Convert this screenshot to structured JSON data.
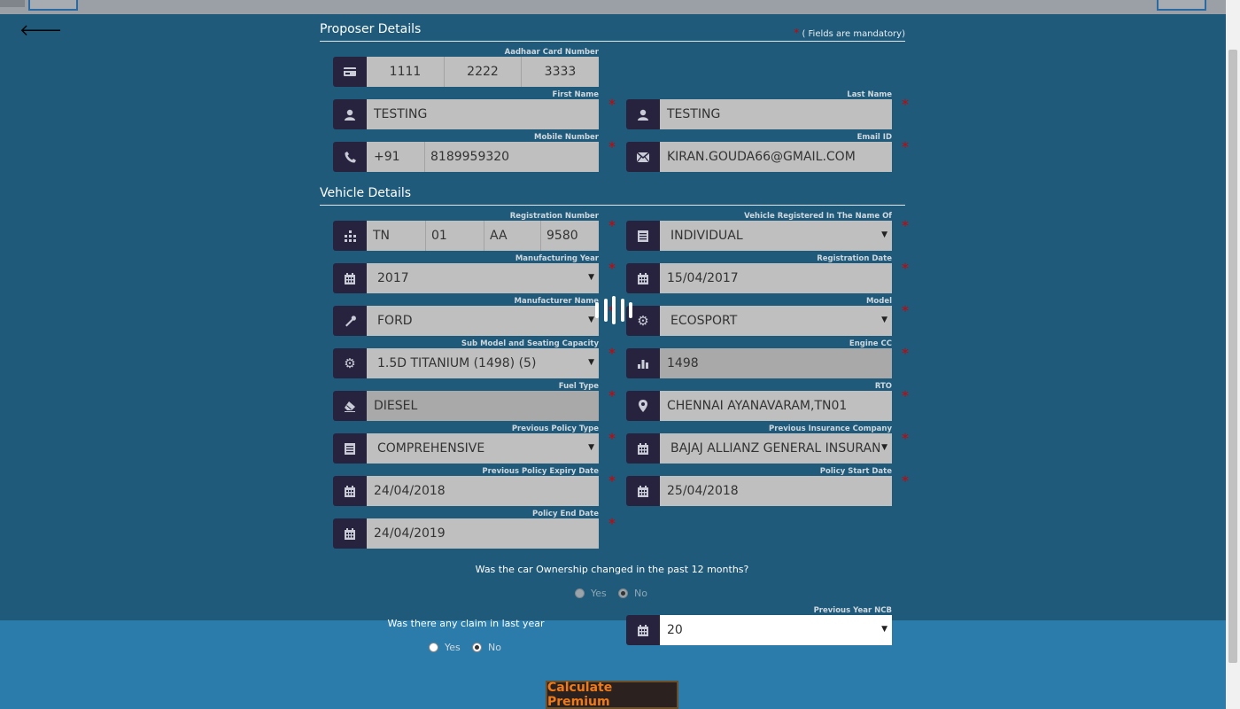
{
  "page": {
    "mandatory_star": "*",
    "mandatory_note": "( Fields are mandatory)"
  },
  "proposer": {
    "title": "Proposer Details",
    "aadhaar": {
      "label": "Aadhaar Card Number",
      "parts": [
        "1111",
        "2222",
        "3333"
      ],
      "icon": "id-card-icon"
    },
    "first_name": {
      "label": "First Name",
      "value": "TESTING",
      "icon": "user-icon"
    },
    "last_name": {
      "label": "Last Name",
      "value": "TESTING",
      "icon": "user-icon"
    },
    "mobile": {
      "label": "Mobile Number",
      "code": "+91",
      "value": "8189959320",
      "icon": "phone-icon"
    },
    "email": {
      "label": "Email ID",
      "value": "KIRAN.GOUDA66@GMAIL.COM",
      "icon": "envelope-icon"
    }
  },
  "vehicle": {
    "title": "Vehicle Details",
    "registration_number": {
      "label": "Registration Number",
      "parts": [
        "TN",
        "01",
        "AA",
        "9580"
      ],
      "icon": "building-icon"
    },
    "registered_name": {
      "label": "Vehicle Registered In The Name Of",
      "value": "INDIVIDUAL",
      "icon": "list-icon"
    },
    "manufacturing_year": {
      "label": "Manufacturing Year",
      "value": "2017",
      "icon": "calendar-icon"
    },
    "registration_date": {
      "label": "Registration Date",
      "value": "15/04/2017",
      "icon": "calendar-icon"
    },
    "manufacturer": {
      "label": "Manufacturer Name",
      "value": "FORD",
      "icon": "wrench-icon"
    },
    "model": {
      "label": "Model",
      "value": "ECOSPORT",
      "icon": "gear-icon"
    },
    "sub_model": {
      "label": "Sub Model and Seating Capacity",
      "value": "1.5D TITANIUM (1498) (5)",
      "icon": "gear-icon"
    },
    "engine_cc": {
      "label": "Engine CC",
      "value": "1498",
      "icon": "bar-chart-icon"
    },
    "fuel_type": {
      "label": "Fuel Type",
      "value": "DIESEL",
      "icon": "eraser-icon"
    },
    "rto": {
      "label": "RTO",
      "value": "CHENNAI AYANAVARAM,TN01",
      "icon": "map-pin-icon"
    },
    "prev_policy_type": {
      "label": "Previous Policy Type",
      "value": "COMPREHENSIVE",
      "icon": "list-icon"
    },
    "prev_insurer": {
      "label": "Previous Insurance Company",
      "value": "BAJAJ ALLIANZ GENERAL INSURANC",
      "icon": "calendar-icon"
    },
    "prev_expiry": {
      "label": "Previous Policy Expiry Date",
      "value": "24/04/2018",
      "icon": "calendar-icon"
    },
    "policy_start": {
      "label": "Policy Start Date",
      "value": "25/04/2018",
      "icon": "calendar-icon"
    },
    "policy_end": {
      "label": "Policy End Date",
      "value": "24/04/2019",
      "icon": "calendar-icon"
    }
  },
  "ownership": {
    "question": "Was the car Ownership changed in the past 12 months?",
    "yes": "Yes",
    "no": "No",
    "selected": "No"
  },
  "claim": {
    "question": "Was there any claim in last year",
    "yes": "Yes",
    "no": "No",
    "selected": "No"
  },
  "ncb": {
    "label": "Previous Year NCB",
    "value": "20",
    "icon": "calendar-icon"
  },
  "actions": {
    "calculate": "Calculate Premium"
  }
}
